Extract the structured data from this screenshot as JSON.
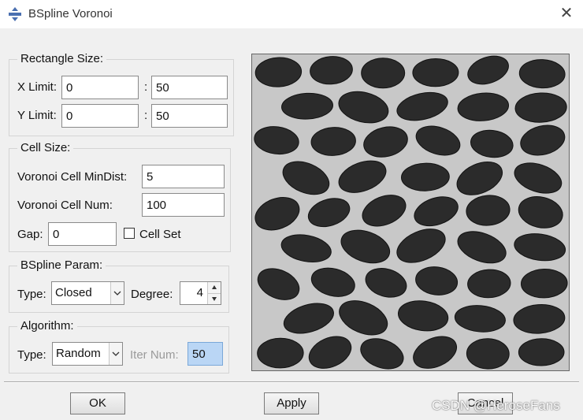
{
  "window": {
    "title": "BSpline Voronoi",
    "close_glyph": "✕"
  },
  "rectangle": {
    "title": "Rectangle Size:",
    "x_label": "X Limit:",
    "x_min": "0",
    "x_sep": ":",
    "x_max": "50",
    "y_label": "Y Limit:",
    "y_min": "0",
    "y_sep": ":",
    "y_max": "50"
  },
  "cell": {
    "title": "Cell Size:",
    "mindist_label": "Voronoi Cell MinDist:",
    "mindist": "5",
    "num_label": "Voronoi Cell Num:",
    "num": "100",
    "gap_label": "Gap:",
    "gap": "0",
    "cellset_label": "Cell Set",
    "cellset_checked": false
  },
  "bspline": {
    "title": "BSpline Param:",
    "type_label": "Type:",
    "type_value": "Closed",
    "degree_label": "Degree:",
    "degree_value": "4"
  },
  "algorithm": {
    "title": "Algorithm:",
    "type_label": "Type:",
    "type_value": "Random",
    "iter_label": "Iter Num:",
    "iter_value": "50"
  },
  "buttons": {
    "ok": "OK",
    "apply": "Apply",
    "cancel": "Cancel"
  },
  "watermark": "CSDN @HeroseFans",
  "colors": {
    "cell_fill": "#2b2b2b",
    "preview_bg": "#c8c8c8",
    "highlight": "#bad6f5"
  }
}
